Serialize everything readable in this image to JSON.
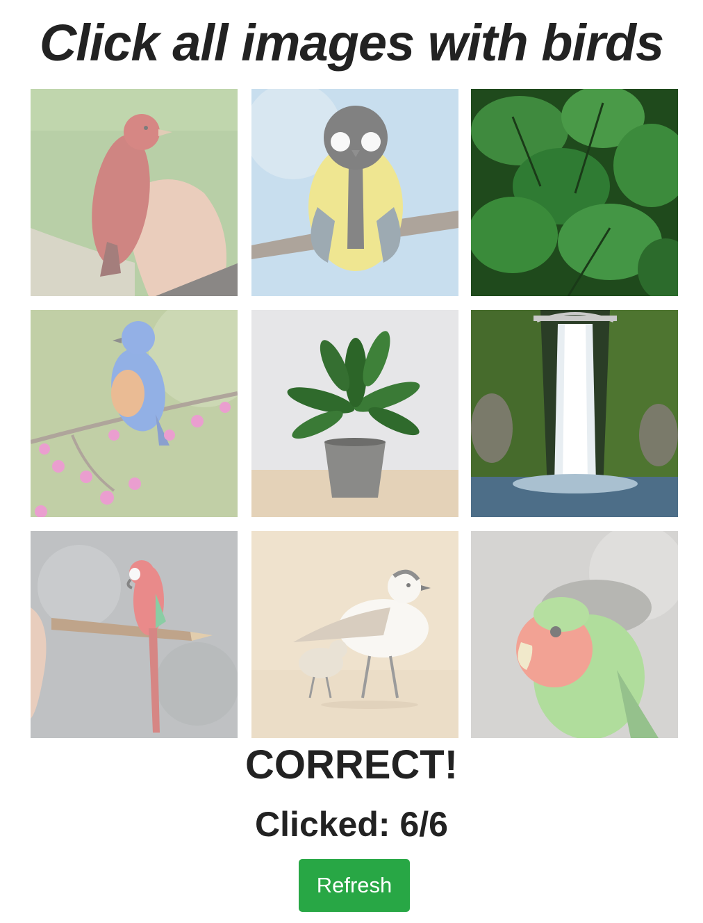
{
  "header": {
    "title": "Click all images with birds"
  },
  "grid": {
    "tiles": [
      {
        "id": "tile-1",
        "subject": "red-tanager-on-hand",
        "selected": true
      },
      {
        "id": "tile-2",
        "subject": "great-tit-on-branch",
        "selected": true
      },
      {
        "id": "tile-3",
        "subject": "green-plant-leaves",
        "selected": false
      },
      {
        "id": "tile-4",
        "subject": "bluebird-on-blossom-branch",
        "selected": true
      },
      {
        "id": "tile-5",
        "subject": "potted-plant",
        "selected": false
      },
      {
        "id": "tile-6",
        "subject": "waterfall-with-bridge",
        "selected": false
      },
      {
        "id": "tile-7",
        "subject": "macaw-on-paintbrush",
        "selected": true
      },
      {
        "id": "tile-8",
        "subject": "plover-with-chick",
        "selected": true
      },
      {
        "id": "tile-9",
        "subject": "lovebird",
        "selected": true
      }
    ]
  },
  "status": {
    "result": "CORRECT!",
    "clicked": "Clicked: 6/6"
  },
  "refresh": {
    "label": "Refresh"
  },
  "colors": {
    "accent": "#28a745",
    "text": "#222222"
  }
}
